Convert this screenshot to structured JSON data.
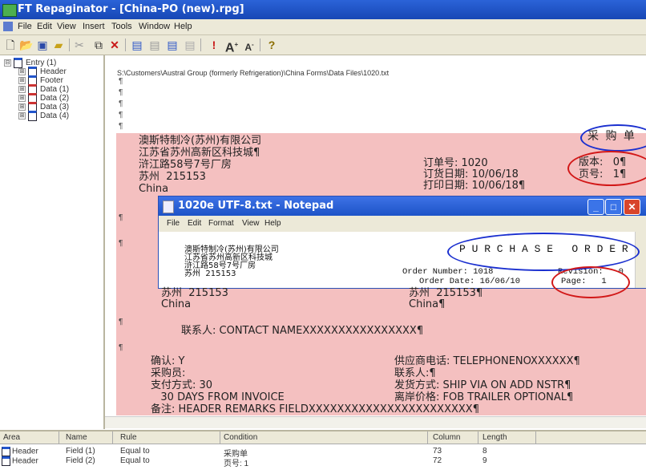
{
  "app": {
    "title": "FT Repaginator - [China-PO (new).rpg]"
  },
  "menu": [
    "File",
    "Edit",
    "View",
    "Insert",
    "Tools",
    "Window",
    "Help"
  ],
  "toolbar": {
    "icons": [
      "new-icon",
      "open-icon",
      "save-icon",
      "open-folder-icon",
      "scissors-icon",
      "properties-icon",
      "delete-icon",
      "align-left-icon",
      "align-center-icon",
      "align-right-icon",
      "justify-icon",
      "exclamation-icon",
      "font-larger-icon",
      "font-smaller-icon",
      "help-icon"
    ]
  },
  "tree": {
    "items": [
      {
        "label": "Entry (1)",
        "expander": "⊟",
        "color": "#2255cc"
      },
      {
        "label": "Header",
        "expander": "⊞",
        "color": "#2255cc"
      },
      {
        "label": "Footer",
        "expander": "⊞",
        "color": "#2255cc"
      },
      {
        "label": "Data (1)",
        "expander": "⊞",
        "color": "#cc3333"
      },
      {
        "label": "Data (2)",
        "expander": "⊞",
        "color": "#cc3333"
      },
      {
        "label": "Data (3)",
        "expander": "⊞",
        "color": "#cc3333"
      },
      {
        "label": "Data (4)",
        "expander": "⊞",
        "color": "#2255cc"
      }
    ]
  },
  "doc": {
    "path": "S:\\Customers\\Austral Group (formerly Refrigeration)\\China Forms\\Data Files\\1020.txt",
    "para": "¶",
    "company_block": "澳斯特制冷(苏州)有限公司\n江苏省苏州高新区科技城¶\n浒江路58号7号厂房\n苏州  215153\nChina",
    "purchase_title": "采 购 单",
    "order_labels": "订单号: 1020\n订货日期: 10/06/18\n打印日期: 10/06/18¶",
    "version_labels": "版本:   0¶\n页号:   1¶",
    "city_left": "苏州  215153\nChina",
    "city_right": "苏州  215153¶\nChina¶",
    "contact": "联系人: CONTACT NAMEXXXXXXXXXXXXXXXX¶",
    "confirm_block": "确认: Y\n采购员:\n支付方式: 30\n   30 DAYS FROM INVOICE\n备注: HEADER REMARKS FIELDXXXXXXXXXXXXXXXXXXXXXXX¶",
    "supplier_block": "供应商电话: TELEPHONENOXXXXXX¶\n联系人:¶\n发货方式: SHIP VIA ON ADD NSTR¶\n离岸价格: FOB TRAILER OPTIONAL¶"
  },
  "notepad": {
    "title": "1020e UTF-8.txt - Notepad",
    "menu": [
      "File",
      "Edit",
      "Format",
      "View",
      "Help"
    ],
    "company": "澳斯特制冷(苏州)有限公司\n江苏省苏州高新区科技城\n浒江路58号7号厂房\n苏州  215153",
    "purchase_order": "P U R C H A S E   O R D E R",
    "order_number_label": "Order Number: 1018",
    "revision": "Revision:   0",
    "order_date": "Order Date: 16/06/10",
    "page": "Page:   1"
  },
  "grid": {
    "headers": [
      "Area",
      "Name",
      "Rule",
      "Condition",
      "Column",
      "Length"
    ],
    "rows": [
      [
        "Header",
        "Field (1)",
        "Equal to",
        "采购单",
        "73",
        "8"
      ],
      [
        "Header",
        "Field (2)",
        "Equal to",
        "页号: 1",
        "72",
        "9"
      ]
    ]
  },
  "colors": {
    "highlight": "#f4c0c0",
    "titlebar": "#1d53c7",
    "annotation_blue": "#1a2fcf",
    "annotation_red": "#d21818"
  }
}
